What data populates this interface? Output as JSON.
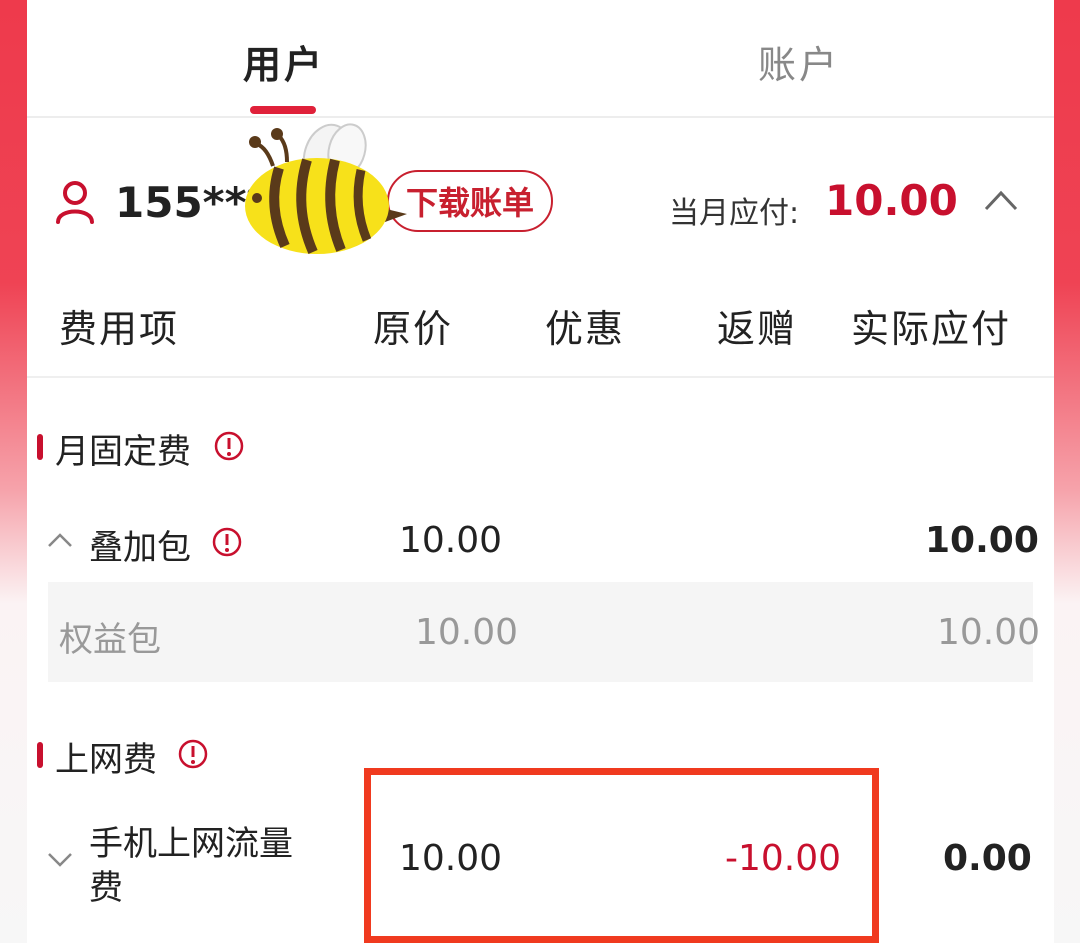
{
  "tabs": {
    "user": "用户",
    "account": "账户"
  },
  "user": {
    "phone_masked": "155***",
    "download_label": "下载账单",
    "due_label": "当月应付:",
    "due_value": "10.00"
  },
  "table": {
    "headers": [
      "费用项",
      "原价",
      "优惠",
      "返赠",
      "实际应付"
    ]
  },
  "sections": [
    {
      "title": "月固定费",
      "item": {
        "label": "叠加包",
        "original": "10.00",
        "actual": "10.00"
      },
      "sub": {
        "label": "权益包",
        "original": "10.00",
        "actual": "10.00"
      }
    },
    {
      "title": "上网费",
      "item": {
        "label_line1": "手机上网流量",
        "label_line2": "费",
        "original": "10.00",
        "rebate": "-10.00",
        "actual": "0.00"
      }
    }
  ],
  "colors": {
    "accent": "#c8102e",
    "highlight": "#f03a1f"
  },
  "icons": [
    "user-icon",
    "chevron-up-icon",
    "info-icon",
    "chevron-down-icon",
    "bee-sticker"
  ]
}
